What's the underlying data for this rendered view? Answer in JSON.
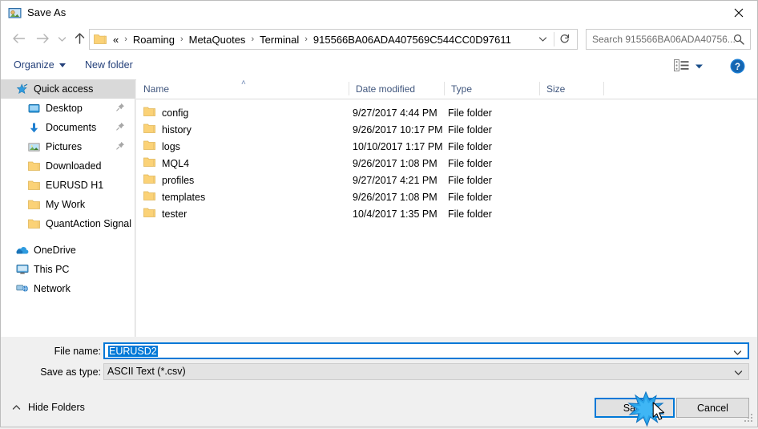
{
  "window": {
    "title": "Save As",
    "title_icon": "save-as-icon",
    "close_icon": "close-icon"
  },
  "nav": {
    "back_icon": "arrow-left-icon",
    "forward_icon": "arrow-right-icon",
    "recent_icon": "chevron-down-icon",
    "up_icon": "arrow-up-icon",
    "refresh_icon": "refresh-icon",
    "address_chevron_icon": "chevron-down-icon",
    "breadcrumbs": [
      "«",
      "Roaming",
      "MetaQuotes",
      "Terminal",
      "915566BA06ADA407569C544CC0D97611"
    ],
    "separator": "›"
  },
  "search": {
    "placeholder": "Search 915566BA06ADA40756...",
    "icon": "search-icon"
  },
  "toolbar": {
    "organize_label": "Organize",
    "new_folder_label": "New folder",
    "view_icon": "view-layout-icon",
    "view_caret_icon": "chevron-down-icon",
    "help_icon": "help-icon"
  },
  "sidebar": {
    "items": [
      {
        "label": "Quick access",
        "icon": "star-pin-icon",
        "level": 0,
        "selected": true,
        "pinned": false
      },
      {
        "label": "Desktop",
        "icon": "desktop-icon",
        "level": 1,
        "selected": false,
        "pinned": true
      },
      {
        "label": "Documents",
        "icon": "documents-icon",
        "level": 1,
        "selected": false,
        "pinned": true
      },
      {
        "label": "Pictures",
        "icon": "pictures-icon",
        "level": 1,
        "selected": false,
        "pinned": true
      },
      {
        "label": "Downloaded",
        "icon": "folder-icon",
        "level": 1,
        "selected": false,
        "pinned": false
      },
      {
        "label": "EURUSD H1",
        "icon": "folder-icon",
        "level": 1,
        "selected": false,
        "pinned": false
      },
      {
        "label": "My Work",
        "icon": "folder-icon",
        "level": 1,
        "selected": false,
        "pinned": false
      },
      {
        "label": "QuantAction Signal",
        "icon": "folder-icon",
        "level": 1,
        "selected": false,
        "pinned": false
      },
      {
        "label": "OneDrive",
        "icon": "onedrive-icon",
        "level": 0,
        "selected": false,
        "pinned": false
      },
      {
        "label": "This PC",
        "icon": "thispc-icon",
        "level": 0,
        "selected": false,
        "pinned": false
      },
      {
        "label": "Network",
        "icon": "network-icon",
        "level": 0,
        "selected": false,
        "pinned": false
      }
    ]
  },
  "filelist": {
    "columns": [
      "Name",
      "Date modified",
      "Type",
      "Size"
    ],
    "sort_column": "Name",
    "sort_indicator": "˄",
    "rows": [
      {
        "name": "config",
        "date": "9/27/2017 4:44 PM",
        "type": "File folder",
        "size": ""
      },
      {
        "name": "history",
        "date": "9/26/2017 10:17 PM",
        "type": "File folder",
        "size": ""
      },
      {
        "name": "logs",
        "date": "10/10/2017 1:17 PM",
        "type": "File folder",
        "size": ""
      },
      {
        "name": "MQL4",
        "date": "9/26/2017 1:08 PM",
        "type": "File folder",
        "size": ""
      },
      {
        "name": "profiles",
        "date": "9/27/2017 4:21 PM",
        "type": "File folder",
        "size": ""
      },
      {
        "name": "templates",
        "date": "9/26/2017 1:08 PM",
        "type": "File folder",
        "size": ""
      },
      {
        "name": "tester",
        "date": "10/4/2017 1:35 PM",
        "type": "File folder",
        "size": ""
      }
    ]
  },
  "fields": {
    "filename_label": "File name:",
    "filename_value": "EURUSD2",
    "savetype_label": "Save as type:",
    "savetype_value": "ASCII Text (*.csv)",
    "dropdown_icon": "chevron-down-icon"
  },
  "footer": {
    "hide_folders_label": "Hide Folders",
    "hide_folders_icon": "chevron-up-icon",
    "save_label": "Save",
    "cancel_label": "Cancel",
    "resize_grip_icon": "resize-grip-icon",
    "cursor_icon": "mouse-pointer-icon",
    "click_burst_icon": "click-burst-icon"
  },
  "colors": {
    "accent": "#0078d7",
    "selection": "#0078d7",
    "sidebar_selected": "#d9d9d9",
    "folder": "#fbd277",
    "header_text": "#41577e",
    "link_text": "#24407a",
    "dialog_bg": "#f0f0f0"
  }
}
